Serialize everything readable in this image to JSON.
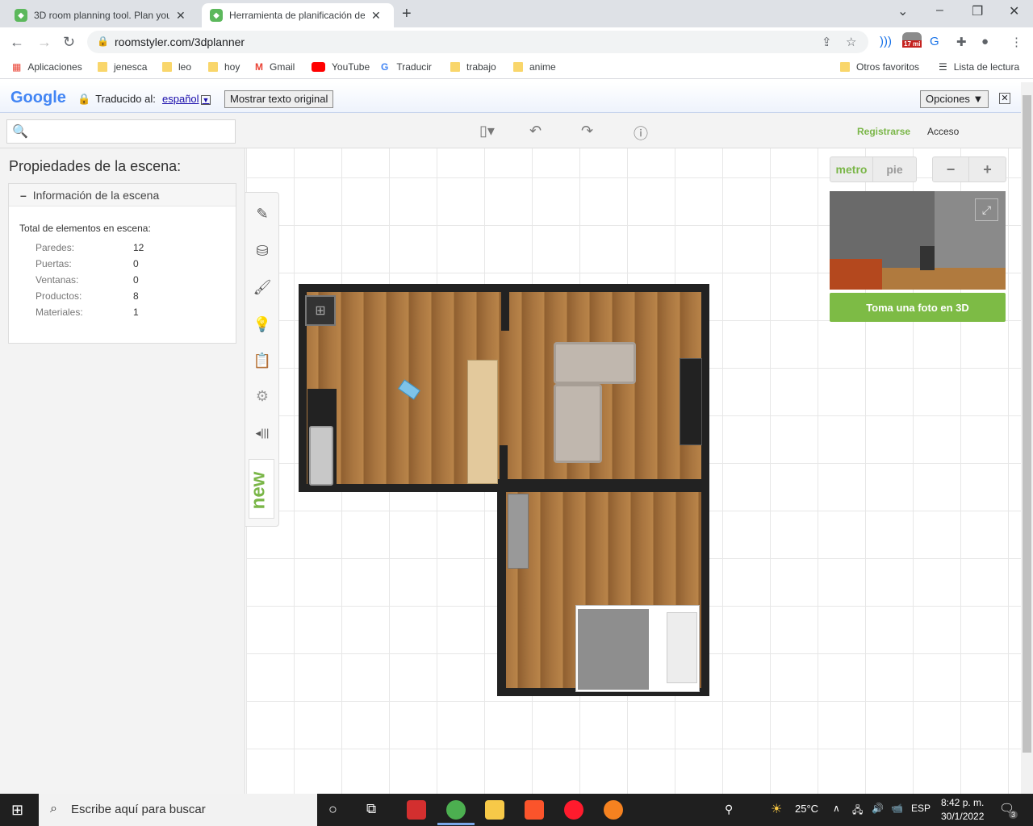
{
  "browser": {
    "tabs": [
      {
        "title": "3D room planning tool. Plan your"
      },
      {
        "title": "Herramienta de planificación de "
      }
    ],
    "url": "roomstyler.com/3dplanner",
    "extension_badge": "17 mi",
    "bookmarks": [
      {
        "label": "Aplicaciones"
      },
      {
        "label": "jenesca"
      },
      {
        "label": "leo"
      },
      {
        "label": "hoy"
      },
      {
        "label": "Gmail"
      },
      {
        "label": "YouTube"
      },
      {
        "label": "Traducir"
      },
      {
        "label": "trabajo"
      },
      {
        "label": "anime"
      },
      {
        "label": "Otros favoritos"
      },
      {
        "label": "Lista de lectura"
      }
    ]
  },
  "translate_bar": {
    "brand": "Google",
    "translated_to": "Traducido al:",
    "language": "español",
    "show_original": "Mostrar texto original",
    "options": "Opciones ▼"
  },
  "app": {
    "register": "Registrarse",
    "login": "Acceso",
    "panel_title": "Propiedades de la escena:",
    "section_title": "Información de la escena",
    "total_label": "Total de elementos en escena:",
    "stats": [
      {
        "label": "Paredes:",
        "value": "12"
      },
      {
        "label": "Puertas:",
        "value": "0"
      },
      {
        "label": "Ventanas:",
        "value": "0"
      },
      {
        "label": "Productos:",
        "value": "8"
      },
      {
        "label": "Materiales:",
        "value": "1"
      }
    ],
    "new_badge": "new",
    "units": {
      "metric": "metro",
      "imperial": "pie"
    },
    "zoom": {
      "out": "−",
      "in": "+"
    },
    "photo_button": "Toma una foto en 3D"
  },
  "taskbar": {
    "search_placeholder": "Escribe aquí para buscar",
    "weather": "25°C",
    "lang": "ESP",
    "time": "8:42 p. m.",
    "date": "30/1/2022",
    "notifications": "3"
  }
}
